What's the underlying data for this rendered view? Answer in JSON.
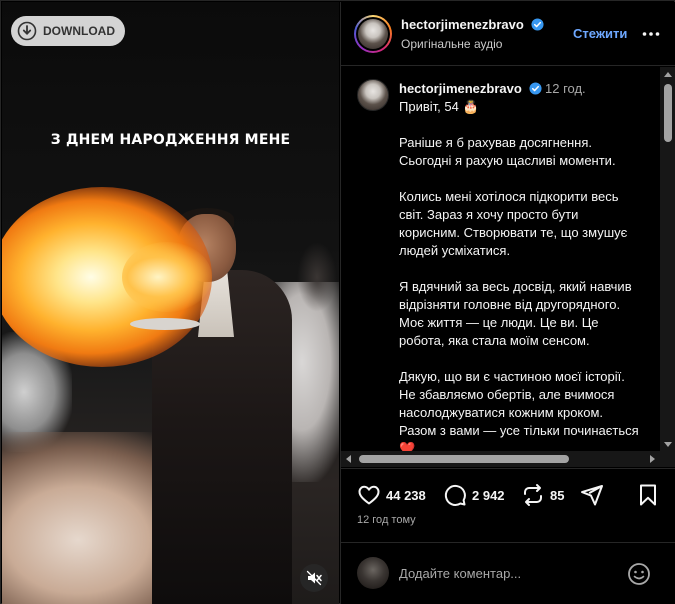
{
  "media": {
    "caption": "З ДНЕМ НАРОДЖЕННЯ МЕНЕ",
    "download_label": "DOWNLOAD",
    "download_icon": "download-icon",
    "mute_icon": "speaker-muted-icon"
  },
  "header": {
    "username": "hectorjimenezbravo",
    "audio": "Оригінальне аудіо",
    "follow_label": "Стежити",
    "more_icon": "more-dots-icon"
  },
  "caption_comment": {
    "username": "hectorjimenezbravo",
    "time": "12 год.",
    "text": "Привіт, 54 🎂\n\nРаніше я б рахував досягнення. Сьогодні я рахую щасливі моменти.\n\nКолись мені хотілося підкорити весь світ. Зараз я хочу просто бути корисним. Створювати те, що змушує людей усміхатися.\n\nЯ вдячний за весь досвід, який навчив відрізняти головне від другорядного. Моє життя — це люди. Це ви. Це робота, яка стала моїм сенсом.\n\nДякую, що ви є частиною моєї історії. Не збавляємо обертів, але вчимося насолоджуватися кожним кроком. Разом з вами — усе тільки починається ❤️"
  },
  "actions": {
    "likes": "44 238",
    "comments": "2 942",
    "reposts": "85",
    "like_icon": "heart-icon",
    "comment_icon": "comment-bubble-icon",
    "repost_icon": "repost-icon",
    "share_icon": "send-icon",
    "save_icon": "bookmark-icon"
  },
  "posted_ago": "12 год тому",
  "add_comment": {
    "placeholder": "Додайте коментар...",
    "emoji_icon": "emoji-smile-icon"
  },
  "colors": {
    "accent_link": "#6ea8ff",
    "verified": "#3797f0",
    "background": "#000000"
  }
}
